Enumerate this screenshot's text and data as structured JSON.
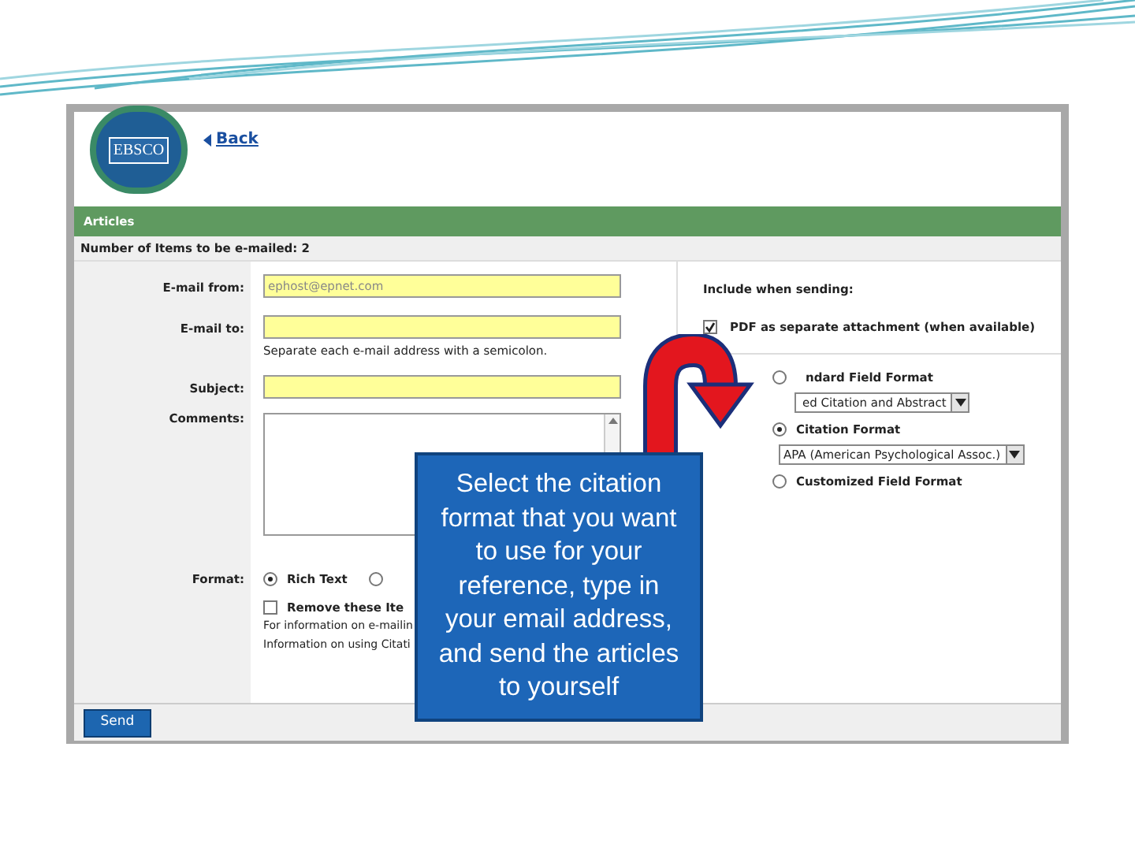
{
  "header": {
    "logo_text": "EBSCO",
    "back_link": "Back"
  },
  "section_bar": "Articles",
  "item_count": "Number of Items to be e-mailed: 2",
  "form": {
    "email_from": {
      "label": "E-mail from:",
      "value": "ephost@epnet.com"
    },
    "email_to": {
      "label": "E-mail to:",
      "hint": "Separate each e-mail address with a semicolon."
    },
    "subject": {
      "label": "Subject:"
    },
    "comments": {
      "label": "Comments:"
    },
    "format": {
      "label": "Format:",
      "options": [
        {
          "label": "Rich Text",
          "selected": true
        },
        {
          "selected": false
        }
      ]
    },
    "remove_items": {
      "label": "Remove these Ite",
      "checked": false
    },
    "info_lines": [
      "For information on e-mailin",
      "Information on using Citati"
    ]
  },
  "include": {
    "title": "Include when sending:",
    "pdf": {
      "label": "PDF as separate attachment (when available)",
      "checked": true
    }
  },
  "formats": [
    {
      "label": "ndard Field Format",
      "selected": false,
      "dropdown": "ed Citation and Abstract"
    },
    {
      "label": "Citation Format",
      "selected": true,
      "dropdown": "APA (American Psychological Assoc.)"
    },
    {
      "label": "Customized Field Format",
      "selected": false
    }
  ],
  "send_button": "Send",
  "callout": "Select the citation format that you want to use for your reference, type in your email address, and send the articles to yourself"
}
